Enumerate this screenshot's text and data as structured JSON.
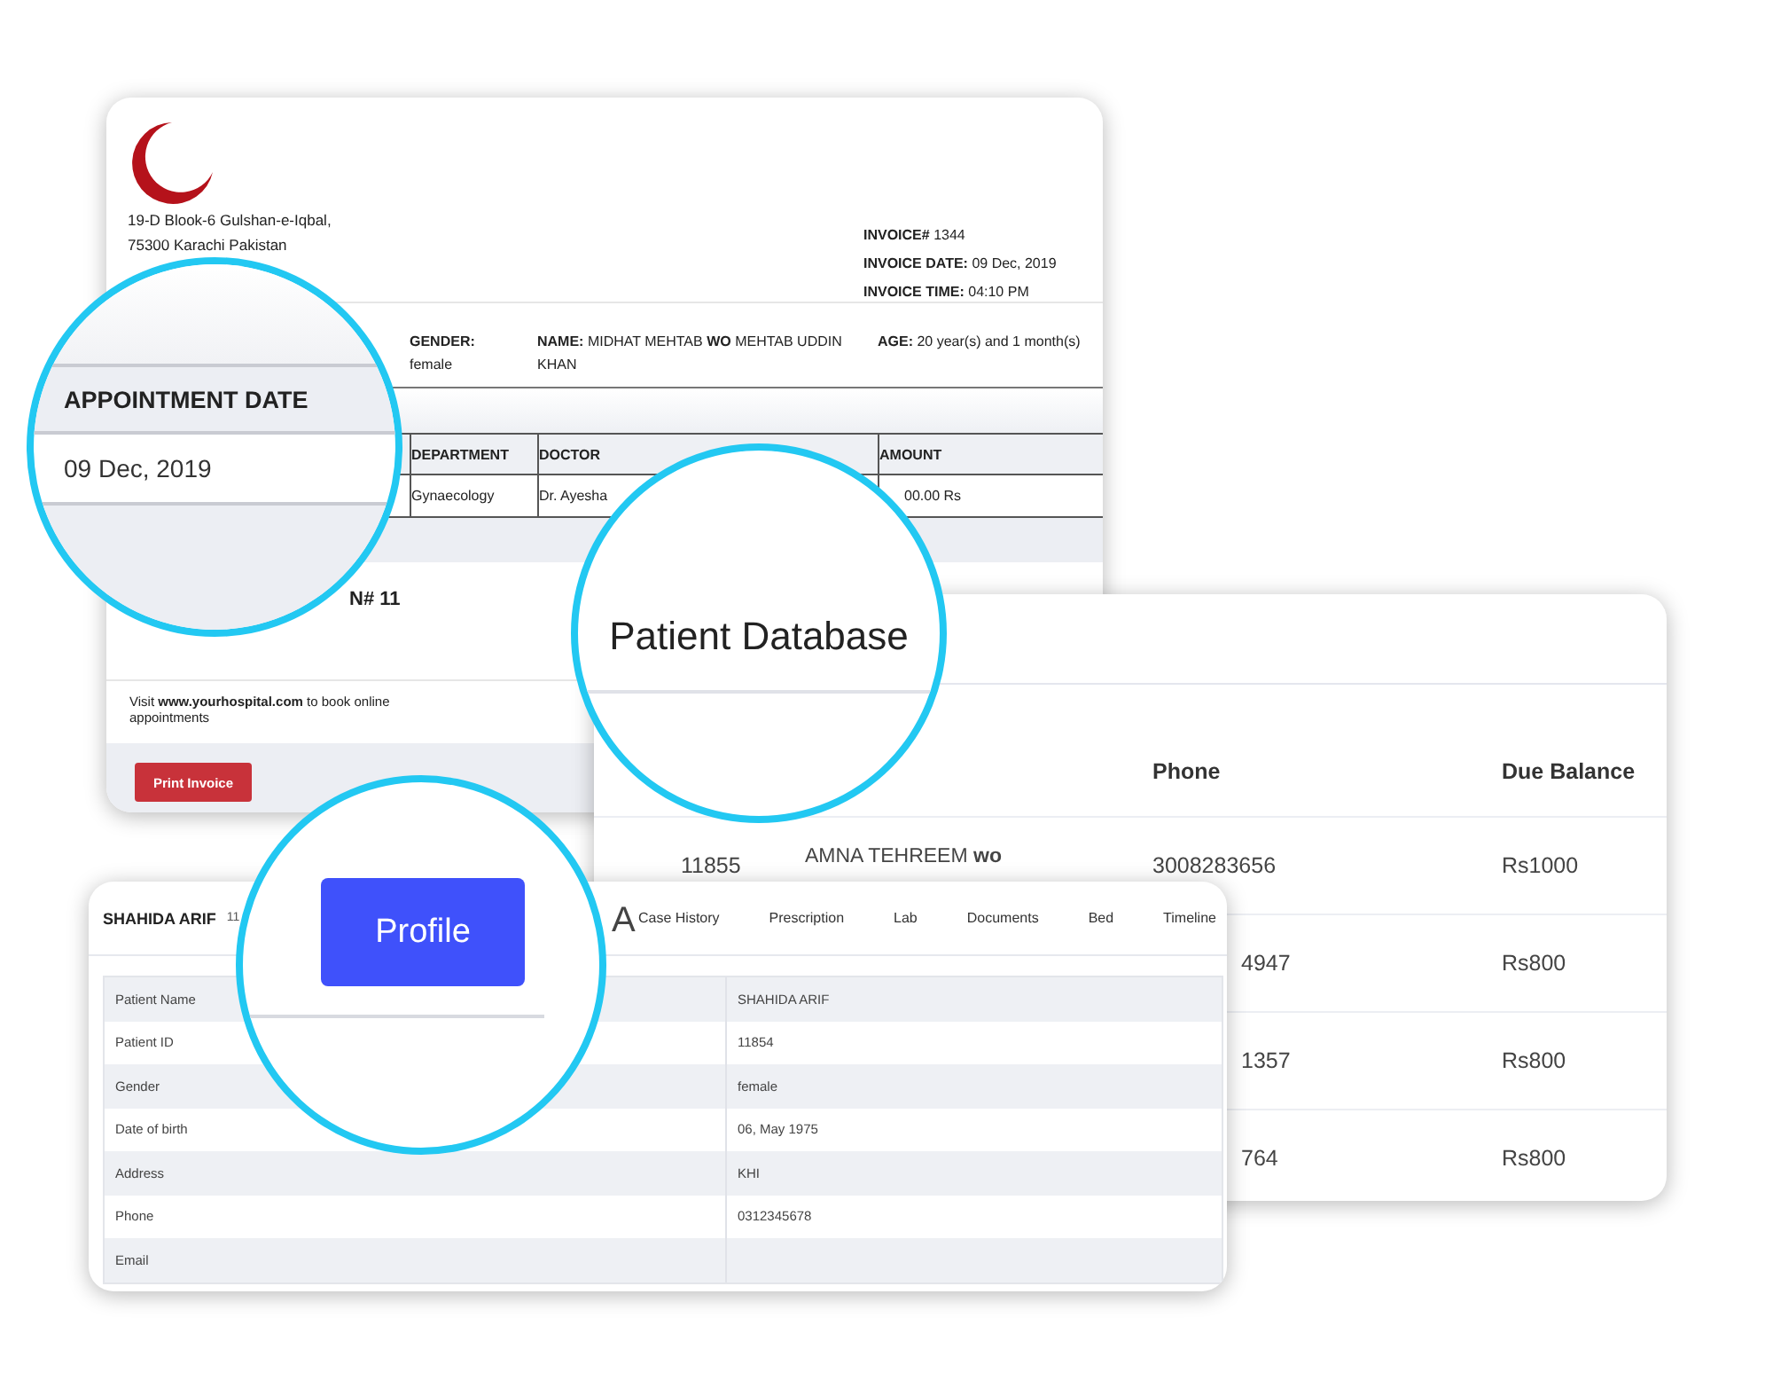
{
  "invoice": {
    "address": [
      "19-D Blook-6 Gulshan-e-Iqbal,",
      "75300 Karachi Pakistan"
    ],
    "invoice_info": [
      {
        "label": "INVOICE#",
        "value": "1344"
      },
      {
        "label": "INVOICE DATE:",
        "value": "09 Dec, 2019"
      },
      {
        "label": "INVOICE TIME:",
        "value": "04:10 PM"
      }
    ],
    "patient_info": [
      {
        "label": "GENDER:",
        "value": "female"
      },
      {
        "label": "NAME:",
        "value": "MIDHAT MEHTAB **WO** MEHTAB UDDIN KHAN"
      },
      {
        "label": "AGE:",
        "value": "20 year(s) and 1 month(s)"
      }
    ],
    "table": {
      "columns": [
        "DEPARTMENT",
        "DOCTOR",
        "AMOUNT"
      ],
      "row": [
        "Gynaecology",
        "Dr. Ayesha",
        "00.00 Rs"
      ]
    },
    "token": "N# 11",
    "footer": "Visit **www.yourhospital.com** to book online appointments",
    "print_button": "Print Invoice"
  },
  "patient_database": {
    "columns": [
      "Phone",
      "Due Balance"
    ],
    "rows": [
      {
        "id": "11855",
        "name": "AMNA TEHREEM **wo**",
        "phone": "3008283656",
        "due": "Rs1000"
      },
      {
        "phone": "4947",
        "due": "Rs800"
      },
      {
        "phone": "1357",
        "due": "Rs800"
      },
      {
        "phone": "764",
        "due": "Rs800"
      }
    ]
  },
  "profile": {
    "name": "SHAHIDA ARIF",
    "id_fragment": "11",
    "heading_fragment": "A",
    "tabs": [
      {
        "label": "Case History",
        "selected": false
      },
      {
        "label": "Prescription",
        "selected": false
      },
      {
        "label": "Lab",
        "selected": false
      },
      {
        "label": "Documents",
        "selected": false
      },
      {
        "label": "Bed",
        "selected": false
      },
      {
        "label": "Timeline",
        "selected": false
      }
    ],
    "rows": [
      {
        "label": "Patient Name",
        "value": "SHAHIDA ARIF"
      },
      {
        "label": "Patient ID",
        "value": "11854"
      },
      {
        "label": "Gender",
        "value": "female"
      },
      {
        "label": "Date of birth",
        "value": "06, May 1975"
      },
      {
        "label": "Address",
        "value": "KHI"
      },
      {
        "label": "Phone",
        "value": "0312345678"
      },
      {
        "label": "Email"
      }
    ]
  },
  "magnifiers": [
    {
      "kind": "appointment",
      "header": "APPOINTMENT DATE",
      "value": "09 Dec, 2019"
    },
    {
      "kind": "heading",
      "text": "Patient Database"
    },
    {
      "kind": "button",
      "label": "Profile",
      "selected": true
    }
  ]
}
